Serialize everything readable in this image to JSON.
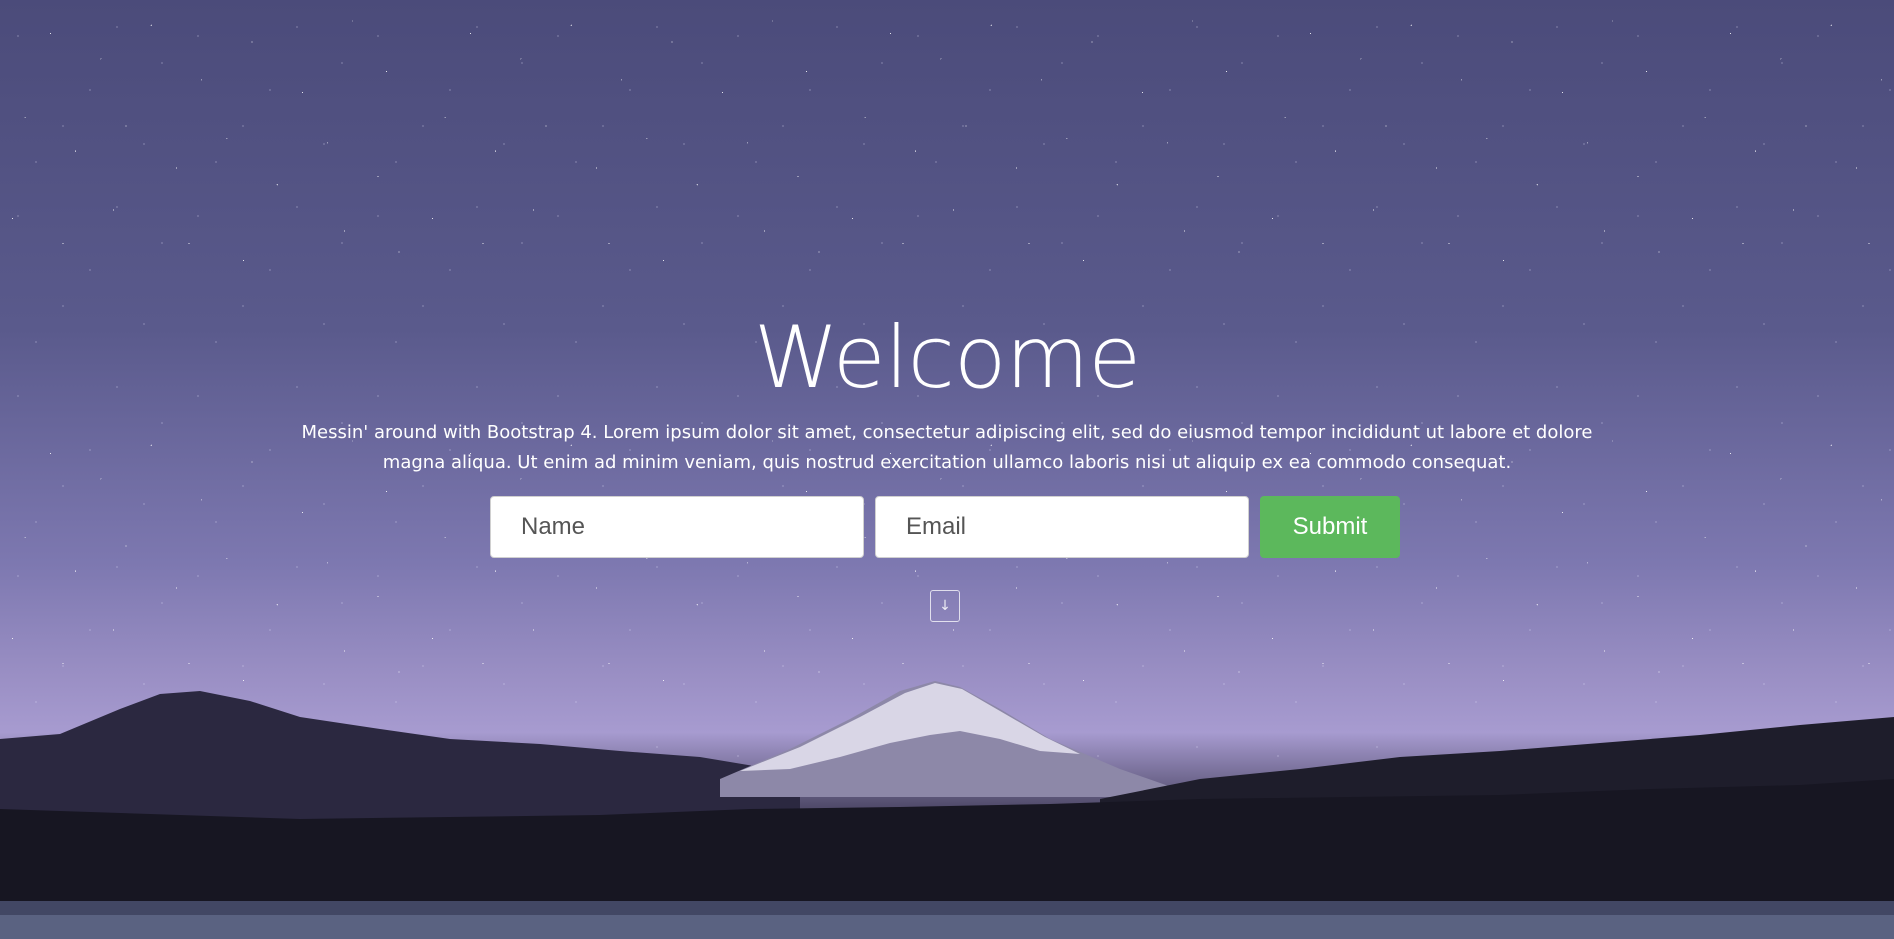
{
  "hero": {
    "title": "Welcome",
    "lead": "Messin' around with Bootstrap 4. Lorem ipsum dolor sit amet, consectetur adipiscing elit, sed do eiusmod tempor incididunt ut labore et dolore magna aliqua. Ut enim ad minim veniam, quis nostrud exercitation ullamco laboris nisi ut aliquip ex ea commodo consequat."
  },
  "form": {
    "name_placeholder": "Name",
    "name_value": "",
    "email_placeholder": "Email",
    "email_value": "",
    "submit_label": "Submit"
  },
  "scroll": {
    "icon": "arrow-down-icon",
    "glyph": "↓"
  },
  "colors": {
    "submit_bg": "#5cb85c",
    "text": "#ffffff",
    "sky": "#5a5a8c"
  }
}
